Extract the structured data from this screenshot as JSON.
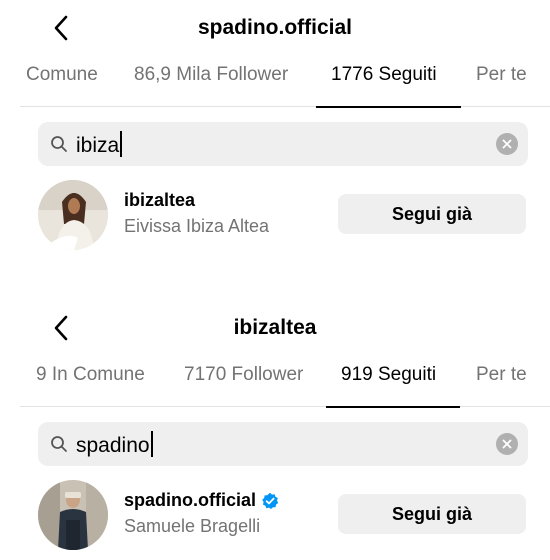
{
  "panel1": {
    "title": "spadino.official",
    "tabs": [
      "Comune",
      "86,9 Mila Follower",
      "1776 Seguiti",
      "Per te"
    ],
    "active_tab": 2,
    "search": {
      "query": "ibiza"
    },
    "result": {
      "username": "ibizaltea",
      "full_name": "Eivissa Ibiza Altea",
      "verified": false,
      "button_label": "Segui già"
    }
  },
  "panel2": {
    "title": "ibizaltea",
    "tabs": [
      "9 In Comune",
      "7170 Follower",
      "919 Seguiti",
      "Per te"
    ],
    "active_tab": 2,
    "search": {
      "query": "spadino"
    },
    "result": {
      "username": "spadino.official",
      "full_name": "Samuele Bragelli",
      "verified": true,
      "button_label": "Segui già"
    }
  },
  "colors": {
    "background": "#ffffff",
    "muted_text": "#737373",
    "search_bg": "#efefef",
    "button_bg": "#efefef",
    "verified_blue": "#0095f6"
  }
}
